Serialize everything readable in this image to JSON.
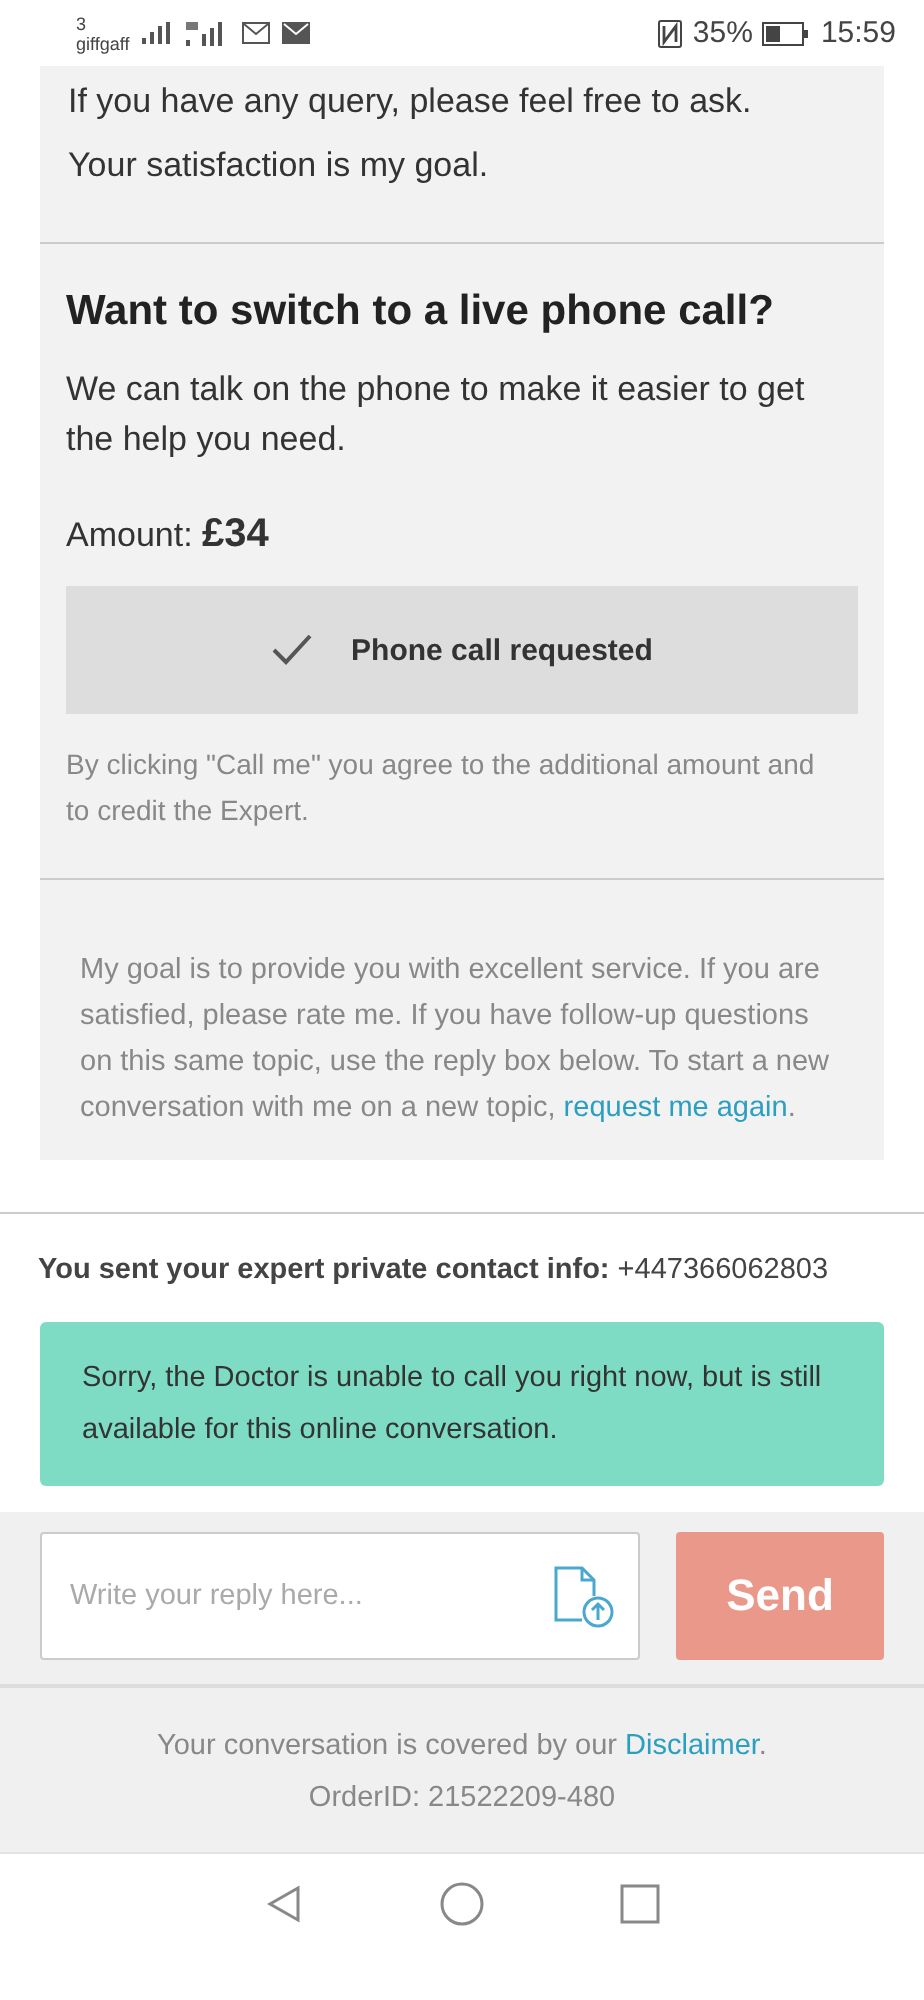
{
  "status_bar": {
    "carrier_index": "3",
    "carrier": "giffgaff",
    "battery": "35%",
    "time": "15:59"
  },
  "intro": [
    "If you have any query, please feel free to ask.",
    "Your satisfaction is my goal."
  ],
  "phone_offer": {
    "title": "Want to switch to a live phone call?",
    "text": "We can talk on the phone to make it easier to get the help you need.",
    "amount": "Amount: **£34**",
    "button": {
      "label": "Phone call requested",
      "checked": true
    },
    "terms": "By clicking \"Call me\" you agree to the additional amount and to credit the Expert."
  },
  "goal_note": {
    "text": "My goal is to provide you with excellent service. If you are satisfied, please rate me. If you have follow-up questions on this same topic, use the reply box below. To start a new conversation with me on a new topic, ",
    "link": "request me again",
    "after": "."
  },
  "contact_info": "**You sent your expert private contact info:** +447366062803",
  "notice": "Sorry, the Doctor is unable to call you right now, but is still available for this online conversation.",
  "reply": {
    "placeholder": "Write your reply here...",
    "send": "Send"
  },
  "footer": {
    "text": "Your conversation is covered by our ",
    "link": "Disclaimer",
    "after": ".",
    "order": "OrderID: 21522209-480"
  }
}
